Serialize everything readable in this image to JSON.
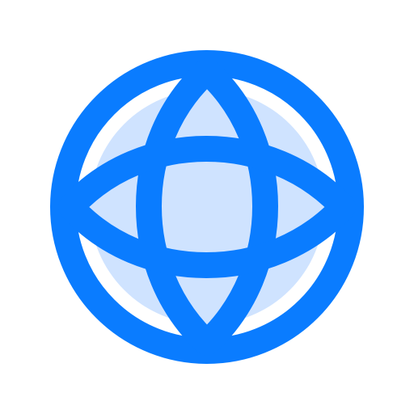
{
  "icon": {
    "name": "globe-icon",
    "colors": {
      "stroke": "#0A7CFF",
      "fill": "#CFE3FF",
      "background": "#FFFFFF"
    }
  }
}
